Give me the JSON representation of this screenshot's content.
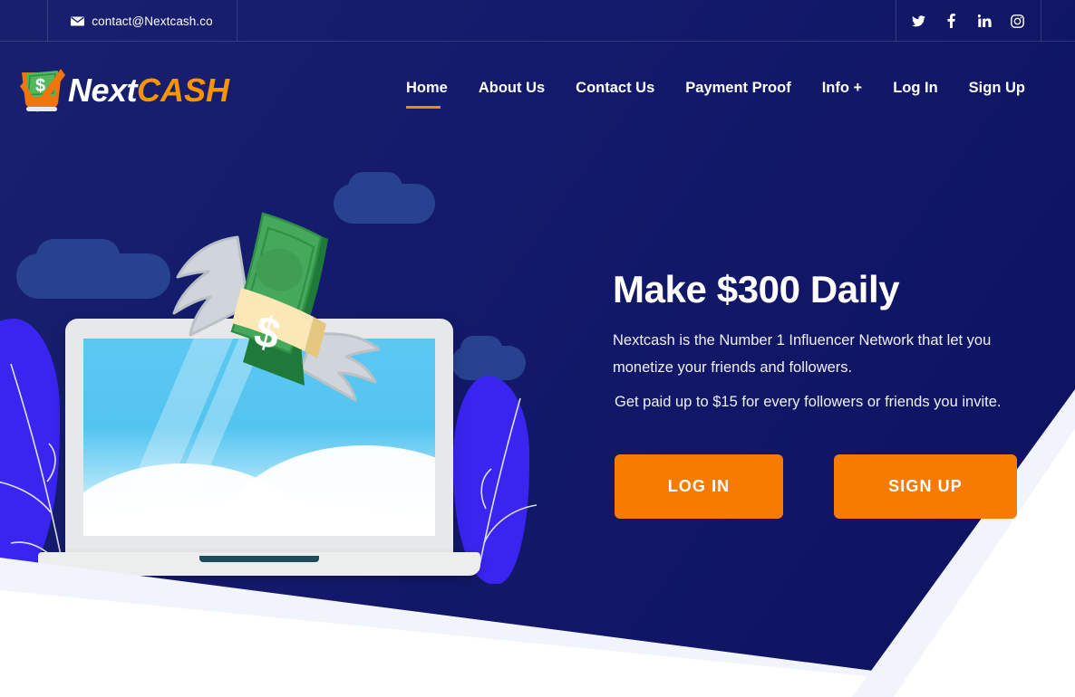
{
  "topbar": {
    "contact_email": "contact@Nextcash.co",
    "mail_icon": "envelope-icon",
    "socials": [
      {
        "name": "twitter-icon",
        "label": "Twitter"
      },
      {
        "name": "facebook-icon",
        "label": "Facebook"
      },
      {
        "name": "linkedin-icon",
        "label": "LinkedIn"
      },
      {
        "name": "instagram-icon",
        "label": "Instagram"
      }
    ]
  },
  "brand": {
    "name_part1": "Next",
    "name_part2": "CASH",
    "mark": "money-check-icon",
    "color_white": "#ffffff",
    "color_orange": "#f79400"
  },
  "nav": {
    "items": [
      {
        "label": "Home",
        "active": true
      },
      {
        "label": "About Us",
        "active": false
      },
      {
        "label": "Contact Us",
        "active": false
      },
      {
        "label": "Payment Proof",
        "active": false
      },
      {
        "label": "Info +",
        "active": false
      },
      {
        "label": "Log In",
        "active": false
      },
      {
        "label": "Sign Up",
        "active": false
      }
    ],
    "active_indicator_color": "#f7860b"
  },
  "hero": {
    "title": "Make $300 Daily",
    "paragraph1": "Nextcash is the Number 1 Influencer Network that let you monetize your friends and followers.",
    "paragraph2": "Get paid up to $15 for every followers or friends you invite.",
    "cta_login": "LOG IN",
    "cta_signup": "SIGN UP",
    "cta_color": "#f77b00"
  },
  "illustration": {
    "name": "laptop-with-flying-money",
    "money_symbol": "$",
    "background_color": "#141a6b",
    "accent_purple": "#3a24f0",
    "cloud_color": "#27428f",
    "screen_color": "#53c4f0",
    "money_green": "#46a85a",
    "money_band": "#f7e3ab",
    "wing_gray": "#cfd4d8"
  }
}
